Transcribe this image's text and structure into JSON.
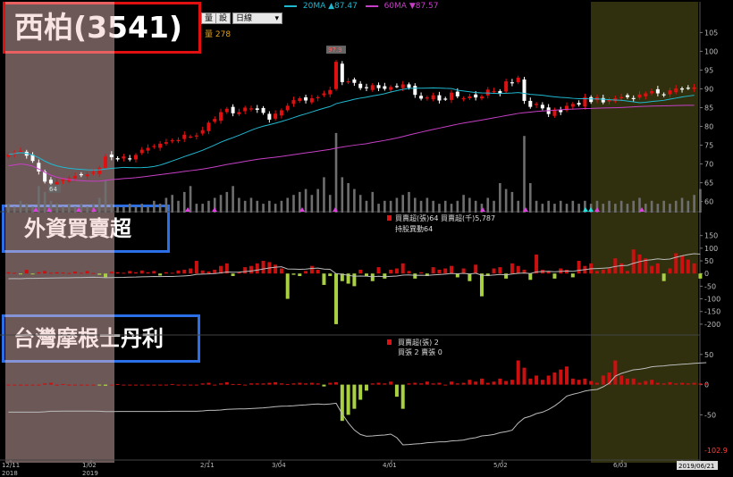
{
  "title": "西柏(3541)",
  "panel_labels": {
    "foreign": "外資買賣超",
    "morgan": "台灣摩根士丹利"
  },
  "toolbar": {
    "btn1": "量",
    "btn2": "設",
    "period": "日線"
  },
  "price_legend": {
    "ma20": {
      "label": "20MA",
      "arrow": "▲",
      "value": "87.47",
      "color": "#1fb8d0"
    },
    "ma60": {
      "label": "60MA",
      "arrow": "▼",
      "value": "87.57",
      "color": "#c63fc6"
    }
  },
  "volume_legend": {
    "label": "量",
    "value": "278"
  },
  "foreign_legend": {
    "line1": "買賣超(張)64 買賣超(千)5,787",
    "line2": "持股異動64"
  },
  "morgan_legend": {
    "line1": "買賣超(張) 2",
    "line2": "買張 2 賣張 0"
  },
  "colors": {
    "up": "#e01010",
    "down": "#ffffff",
    "sell": "#a8d040",
    "buy": "#cc1010",
    "highlight_left": "#f2c4c4",
    "highlight_right": "#6b6b22"
  },
  "chart_data": {
    "type": "candlestick",
    "x_ticks": [
      "12/11\n2018",
      "1/02\n2019",
      "2/11",
      "3/04",
      "4/01",
      "5/02",
      "6/03",
      "2019/06/21"
    ],
    "price_axis": {
      "ticks": [
        60,
        65,
        70,
        75,
        80,
        85,
        90,
        95,
        100,
        105
      ],
      "ylim": [
        58,
        107
      ]
    },
    "price_annotations": {
      "max": "97.9",
      "min": "64"
    },
    "close": [
      72.5,
      73,
      73.5,
      72.2,
      70.8,
      68,
      65.3,
      64.8,
      65.2,
      65.8,
      66.2,
      66.8,
      67,
      67.2,
      67.8,
      69,
      72,
      71.8,
      71.2,
      72,
      71.2,
      72.4,
      73.8,
      74.3,
      74.8,
      75.4,
      75.8,
      76.3,
      76.4,
      77.8,
      77.3,
      77.6,
      79,
      81,
      82,
      83.8,
      84.7,
      83.5,
      83.8,
      85,
      84.8,
      84.4,
      83.6,
      81.8,
      83.4,
      84.3,
      85.5,
      87,
      87.5,
      86.9,
      87.5,
      87.8,
      88.8,
      89.7,
      97.2,
      91.8,
      92,
      91.6,
      90.2,
      90.2,
      91,
      90.2,
      90,
      90.5,
      90.7,
      91.2,
      90.3,
      88.4,
      87.4,
      87.7,
      88.3,
      86.9,
      87.3,
      89,
      88,
      87.5,
      88,
      87.7,
      88,
      89.8,
      89.4,
      88.8,
      92,
      91.5,
      93,
      86.8,
      85.2,
      86,
      84.8,
      83.3,
      84.5,
      83.8,
      85.5,
      86,
      85.8,
      87.8,
      86.5,
      87.8,
      86.4,
      87.2,
      87.5,
      87.8,
      87.8,
      87.4,
      88.5,
      88.8,
      89.4,
      88.8,
      88.3,
      89.6,
      90.1,
      89.8,
      90.2,
      90.4
    ],
    "volume": [
      3,
      2,
      4,
      3,
      2,
      9,
      7,
      4,
      3,
      2,
      3,
      2,
      3,
      2,
      3,
      5,
      11,
      3,
      2,
      2,
      3,
      2,
      3,
      2,
      4,
      3,
      5,
      6,
      4,
      7,
      9,
      3,
      3,
      4,
      5,
      6,
      7,
      9,
      5,
      4,
      5,
      4,
      3,
      4,
      3,
      4,
      5,
      6,
      7,
      8,
      6,
      8,
      12,
      6,
      27,
      12,
      10,
      8,
      6,
      4,
      7,
      3,
      4,
      4,
      5,
      6,
      7,
      5,
      4,
      5,
      4,
      3,
      4,
      3,
      4,
      6,
      5,
      4,
      3,
      5,
      4,
      10,
      8,
      7,
      4,
      26,
      10,
      4,
      3,
      4,
      3,
      4,
      3,
      4,
      3,
      4,
      3,
      4,
      3,
      4,
      3,
      4,
      3,
      4,
      5,
      3,
      4,
      3,
      4,
      3,
      4,
      5,
      4,
      6,
      8
    ],
    "foreign": [
      5,
      3,
      -2,
      15,
      -3,
      5,
      10,
      3,
      5,
      4,
      2,
      8,
      3,
      10,
      2,
      -5,
      -15,
      8,
      5,
      3,
      10,
      5,
      12,
      5,
      10,
      -8,
      5,
      3,
      12,
      15,
      20,
      50,
      12,
      8,
      15,
      30,
      40,
      -10,
      5,
      25,
      30,
      40,
      50,
      45,
      35,
      20,
      -100,
      -5,
      -10,
      10,
      30,
      15,
      -45,
      -10,
      -200,
      -30,
      -40,
      -50,
      15,
      -10,
      -30,
      25,
      -20,
      15,
      20,
      40,
      10,
      -20,
      5,
      -10,
      25,
      15,
      20,
      30,
      -15,
      20,
      -30,
      35,
      -90,
      -10,
      20,
      25,
      -20,
      40,
      30,
      15,
      -25,
      75,
      15,
      10,
      -20,
      20,
      15,
      -15,
      50,
      30,
      40,
      10,
      15,
      20,
      60,
      40,
      10,
      95,
      75,
      60,
      30,
      40,
      -30,
      20,
      80,
      70,
      55,
      40,
      -20
    ],
    "foreign_axis": {
      "ticks": [
        150,
        100,
        50,
        0,
        -50,
        -100,
        -150,
        -200
      ],
      "ylim": [
        -225,
        170
      ]
    },
    "morgan": [
      0,
      0,
      0,
      0,
      0,
      0,
      2,
      3,
      0,
      1,
      0,
      0,
      0,
      0,
      0,
      -1,
      -2,
      0,
      1,
      0,
      0,
      0,
      0,
      0,
      0,
      0,
      0,
      1,
      0,
      0,
      0,
      0,
      2,
      3,
      0,
      2,
      4,
      1,
      1,
      0,
      2,
      2,
      2,
      3,
      4,
      2,
      1,
      2,
      3,
      2,
      3,
      2,
      -3,
      3,
      4,
      -60,
      -50,
      -40,
      -25,
      -10,
      2,
      3,
      2,
      5,
      -20,
      -40,
      2,
      3,
      2,
      5,
      2,
      3,
      0,
      5,
      2,
      3,
      8,
      5,
      10,
      3,
      5,
      10,
      6,
      8,
      40,
      28,
      10,
      15,
      8,
      15,
      20,
      25,
      30,
      10,
      8,
      10,
      6,
      3,
      15,
      20,
      40,
      15,
      10,
      10,
      3,
      6,
      8,
      3,
      2,
      4,
      2,
      3,
      2,
      3,
      2,
      2
    ],
    "morgan_axis": {
      "ticks": [
        50,
        0,
        -50
      ],
      "ylim": [
        -110,
        60
      ],
      "min_label": "-102.9"
    }
  }
}
